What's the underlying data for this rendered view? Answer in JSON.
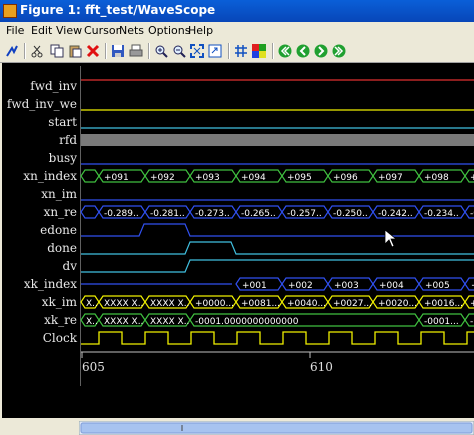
{
  "window": {
    "title": "Figure 1: fft_test/WaveScope"
  },
  "menu": [
    "File",
    "Edit",
    "View",
    "Cursor",
    "Nets",
    "Options",
    "Help"
  ],
  "toolbar": [
    "cursor-arrow-icon",
    "cut-icon",
    "copy-icon",
    "paste-icon",
    "delete-icon",
    "save-icon",
    "print-icon",
    "zoom-in-icon",
    "zoom-out-icon",
    "zoom-fit-icon",
    "export-icon",
    "grid-icon",
    "color-icon",
    "scroll-first-icon",
    "scroll-prev-icon",
    "scroll-next-icon",
    "scroll-last-icon"
  ],
  "colors": {
    "yellow": "#f0f000",
    "green": "#40c040",
    "cyan": "#40c0e0",
    "red": "#e03030",
    "blue": "#3050f0",
    "gray": "#7a7a7a"
  },
  "signals": [
    {
      "name": "fwd_inv",
      "color": "#e03030",
      "type": "high"
    },
    {
      "name": "fwd_inv_we",
      "color": "#f0f000",
      "type": "low"
    },
    {
      "name": "start",
      "color": "#40c0e0",
      "type": "low"
    },
    {
      "name": "rfd",
      "color": "#7a7a7a",
      "type": "fill"
    },
    {
      "name": "busy",
      "color": "#3050f0",
      "type": "low"
    },
    {
      "name": "xn_index",
      "color": "#40c040",
      "type": "bus",
      "values": [
        "+091",
        "+092",
        "+093",
        "+094",
        "+095",
        "+096",
        "+097",
        "+098",
        "+0"
      ]
    },
    {
      "name": "xn_im",
      "color": "#3050f0",
      "type": "low"
    },
    {
      "name": "xn_re",
      "color": "#3050f0",
      "type": "bus",
      "values": [
        "-0.289..",
        "-0.281..",
        "-0.273..",
        "-0.265..",
        "-0.257..",
        "-0.250..",
        "-0.242..",
        "-0.234..",
        "-0."
      ]
    },
    {
      "name": "edone",
      "color": "#3050f0",
      "type": "pulse"
    },
    {
      "name": "done",
      "color": "#40c0e0",
      "type": "pulse"
    },
    {
      "name": "dv",
      "color": "#40c0e0",
      "type": "step"
    },
    {
      "name": "xk_index",
      "color": "#3050f0",
      "type": "bus",
      "values": [
        "+001",
        "+002",
        "+003",
        "+004",
        "+005",
        "+0"
      ]
    },
    {
      "name": "xk_im",
      "color": "#f0f000",
      "type": "bus",
      "values": [
        "X..",
        "XXXX X..",
        "XXXX X..",
        "+0000...",
        "+0081...",
        "+0040...",
        "+0027...",
        "+0020...",
        "+0016...",
        "+"
      ]
    },
    {
      "name": "xk_re",
      "color": "#40c040",
      "type": "bus",
      "values": [
        "X..",
        "XXXX X..",
        "XXXX X..",
        "-0001.0000000000000",
        "-0001...",
        "-"
      ]
    },
    {
      "name": "Clock",
      "color": "#f0f000",
      "type": "clock"
    }
  ],
  "time_axis": {
    "labels": [
      "605",
      "610"
    ]
  }
}
